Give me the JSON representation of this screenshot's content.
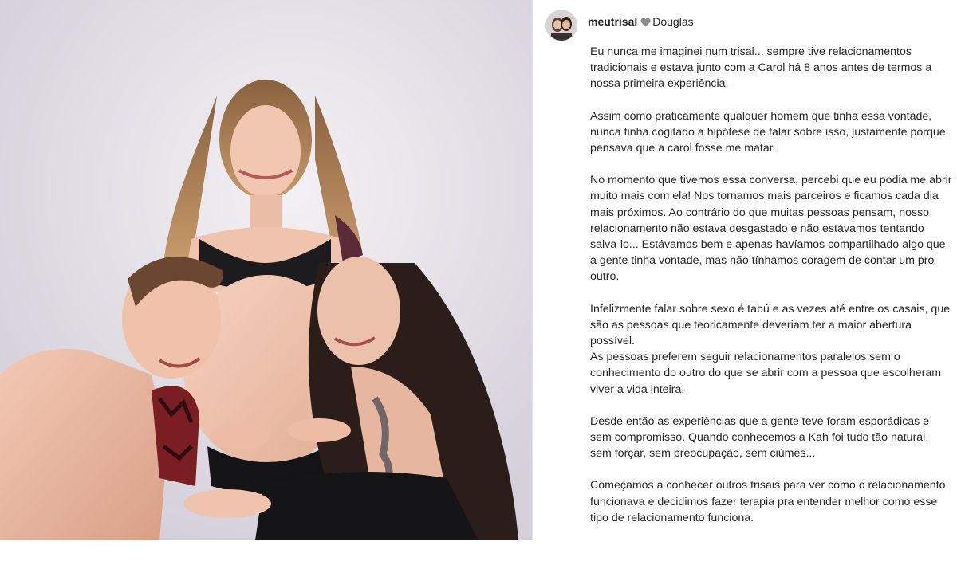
{
  "post": {
    "username": "meutrisal",
    "heart_icon": "heart-icon",
    "partner": "Douglas",
    "paragraphs": [
      "Eu nunca me imaginei num trisal... sempre tive relacionamentos tradicionais e estava junto com a Carol há 8 anos antes de termos a nossa primeira experiência.",
      "Assim como praticamente qualquer homem que tinha essa vontade, nunca tinha cogitado a hipótese de falar sobre isso, justamente porque pensava que a carol fosse me matar.",
      "No momento que tivemos essa conversa, percebi que eu podia me abrir muito mais com ela! Nos tornamos mais parceiros e ficamos cada dia mais próximos. Ao contrário do que muitas pessoas pensam, nosso relacionamento não estava desgastado e não estávamos tentando salva-lo... Estávamos bem e apenas havíamos compartilhado algo que a gente tinha vontade, mas não tínhamos coragem de contar um pro outro.",
      "Infelizmente falar sobre sexo é tabú e as vezes até entre os casais, que são as pessoas que teoricamente deveriam ter a maior abertura possível.",
      "As pessoas preferem seguir relacionamentos paralelos sem o conhecimento do outro do que se abrir com a pessoa que escolheram viver a vida inteira.",
      "Desde então as experiências que a gente teve foram esporádicas e sem compromisso. Quando conhecemos a Kah foi tudo tão natural, sem forçar, sem preocupação, sem ciúmes...",
      "Começamos a conhecer outros trisais para ver como o relacionamento funcionava e decidimos fazer terapia pra entender melhor como esse tipo de relacionamento funciona."
    ]
  },
  "colors": {
    "text": "#262626",
    "heart": "#8e8e8e",
    "backdrop": "#e3dfe7"
  }
}
